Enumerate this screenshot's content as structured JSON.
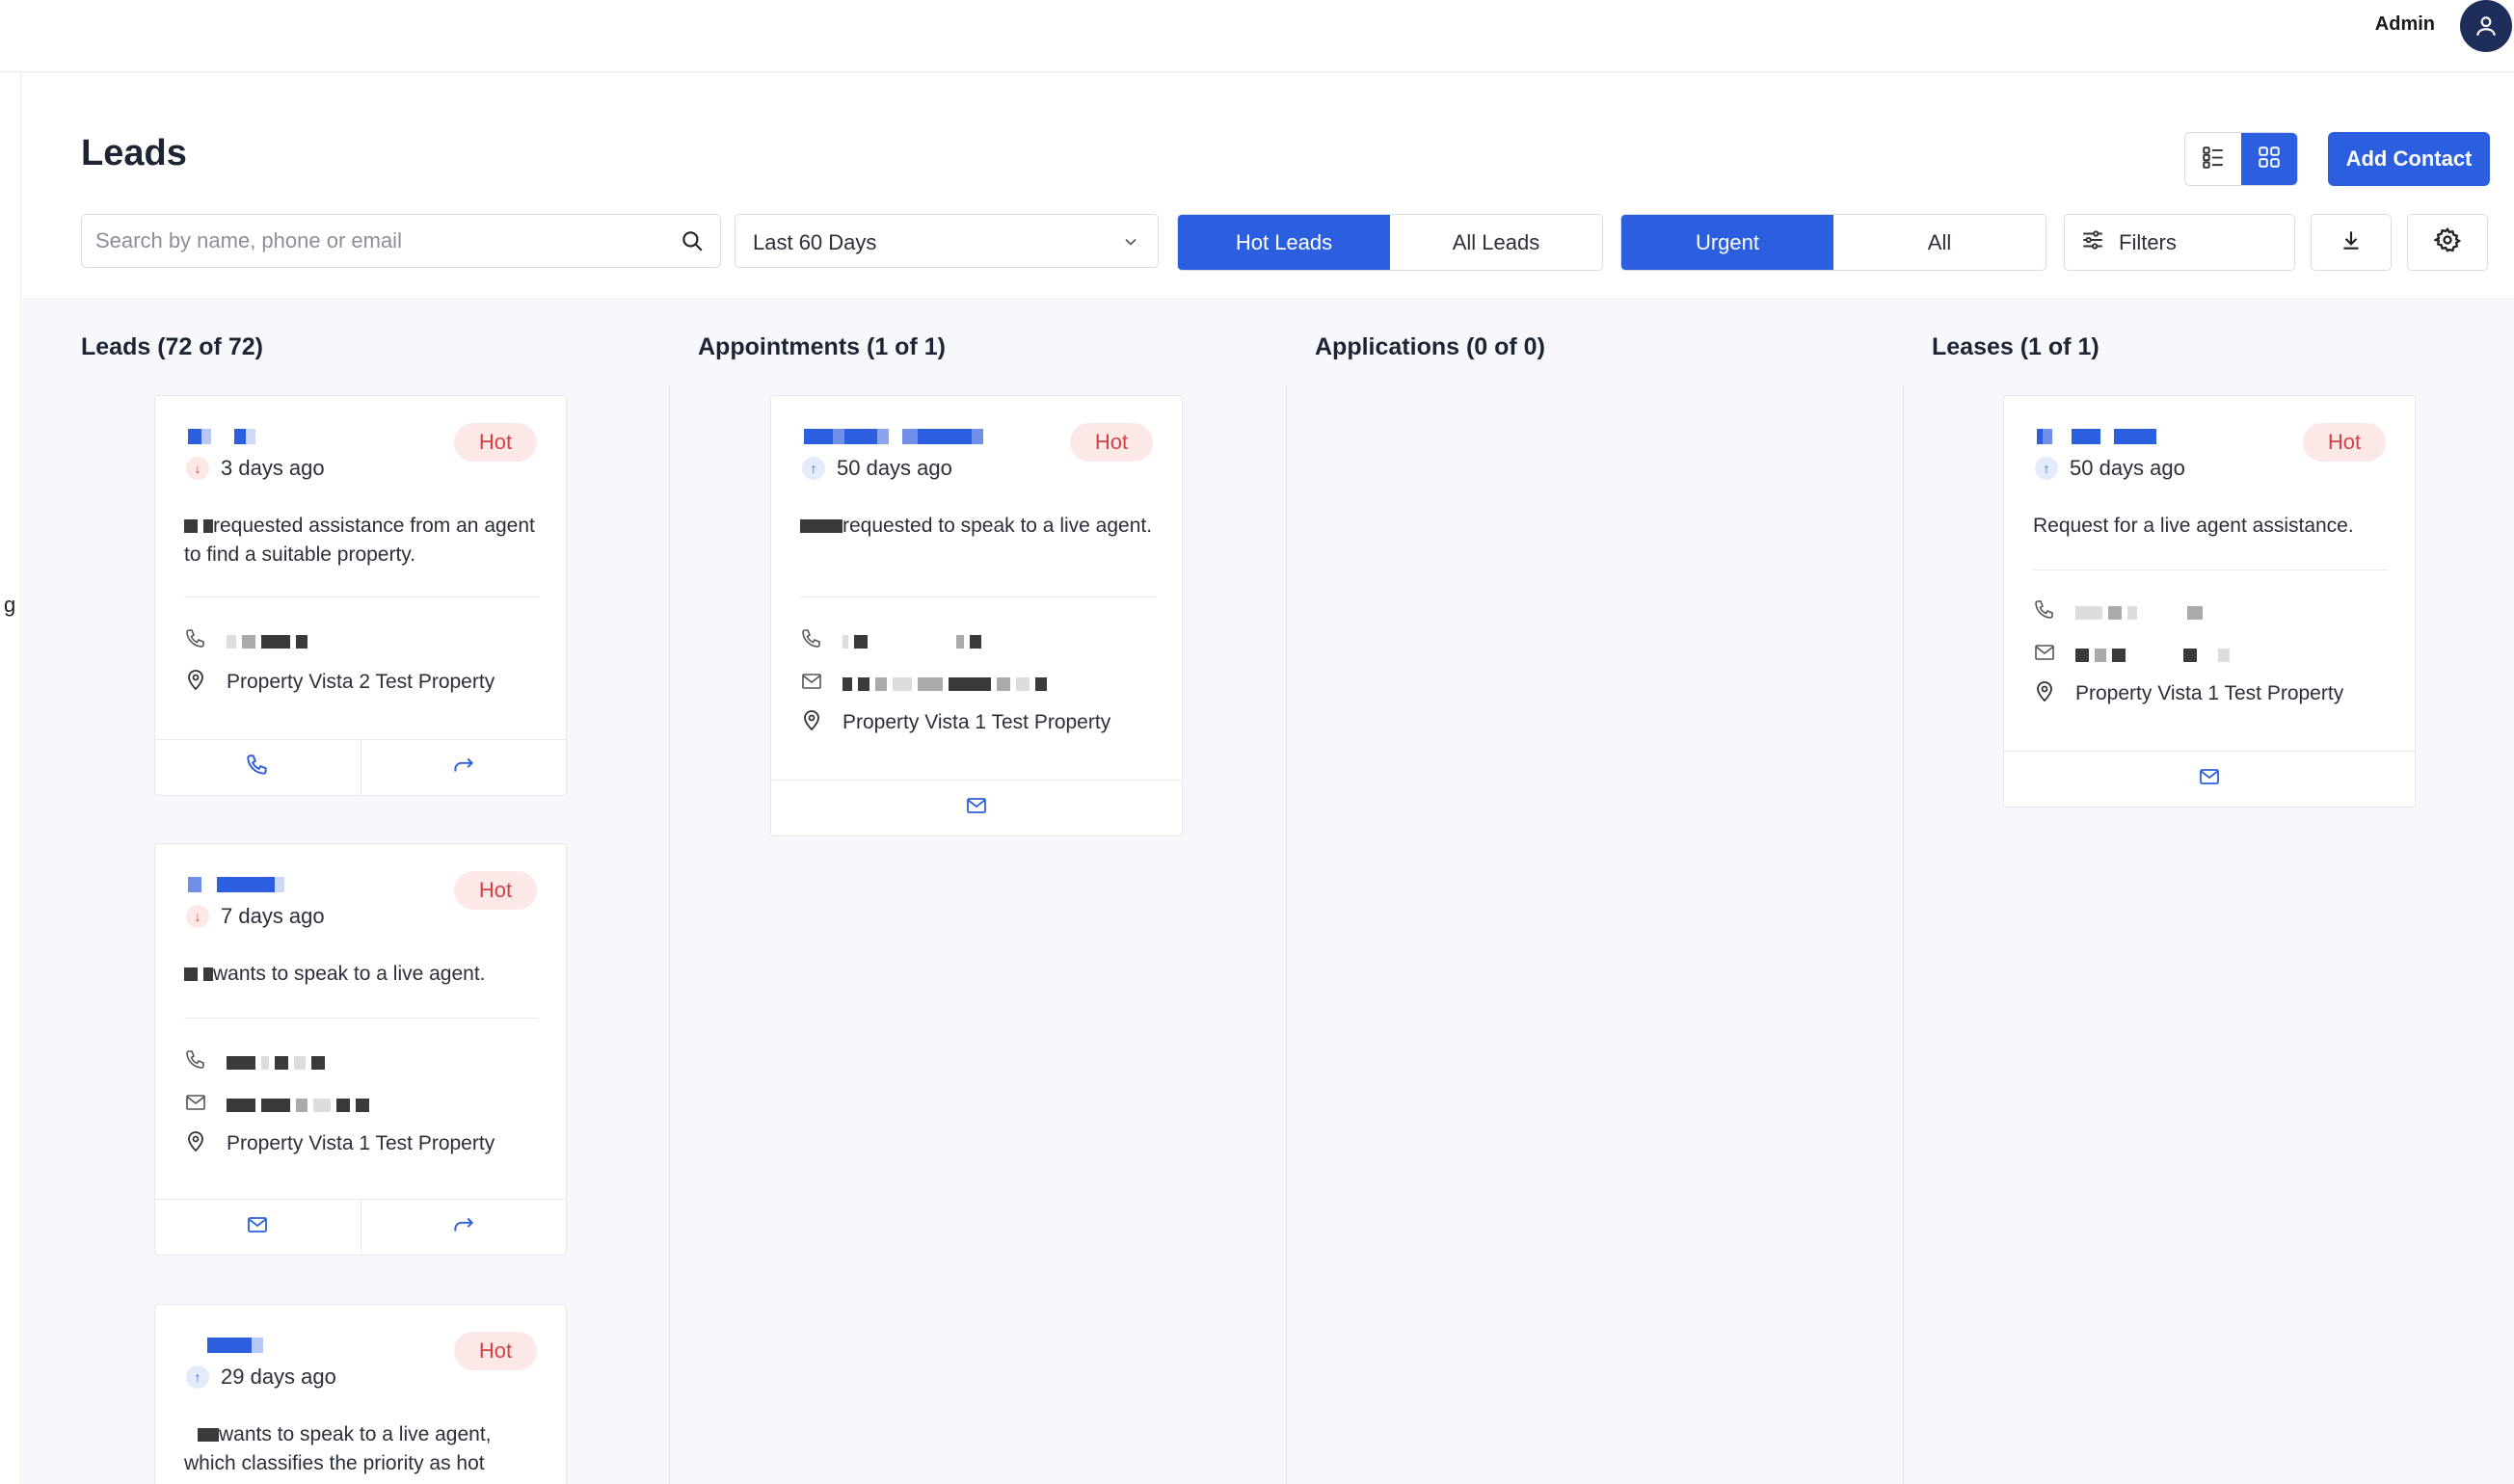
{
  "header": {
    "admin_label": "Admin",
    "page_title": "Leads",
    "add_contact_label": "Add Contact"
  },
  "toolbar": {
    "search_placeholder": "Search by name, phone or email",
    "date_range": "Last 60 Days",
    "lead_type_options": [
      "Hot Leads",
      "All Leads"
    ],
    "lead_type_selected": "Hot Leads",
    "priority_options": [
      "Urgent",
      "All"
    ],
    "priority_selected": "Urgent",
    "filters_label": "Filters"
  },
  "leftrail_char": "g",
  "columns": [
    {
      "title": "Leads (72 of 72)"
    },
    {
      "title": "Appointments (1 of 1)"
    },
    {
      "title": "Applications (0 of 0)"
    },
    {
      "title": "Leases (1 of 1)"
    }
  ],
  "cards": {
    "lead1": {
      "badge": "Hot",
      "time": "3 days ago",
      "trend": "down",
      "description": "requested assistance from an agent to find a suitable property.",
      "property": "Property Vista 2 Test Property"
    },
    "lead2": {
      "badge": "Hot",
      "time": "7 days ago",
      "trend": "down",
      "description": "wants to speak to a live agent.",
      "property": "Property Vista 1 Test Property"
    },
    "lead3": {
      "badge": "Hot",
      "time": "29 days ago",
      "trend": "up",
      "description": "wants to speak to a live agent, which classifies the priority as hot"
    },
    "appt1": {
      "badge": "Hot",
      "time": "50 days ago",
      "trend": "up",
      "description": "requested to speak to a live agent.",
      "property": "Property Vista 1 Test Property"
    },
    "lease1": {
      "badge": "Hot",
      "time": "50 days ago",
      "trend": "up",
      "description": "Request for a live agent assistance.",
      "property": "Property Vista 1 Test Property"
    }
  },
  "colors": {
    "primary": "#2c5fe0",
    "hot_bg": "#fde8e8",
    "hot_text": "#d14343",
    "board_bg": "#f7f8fb"
  }
}
